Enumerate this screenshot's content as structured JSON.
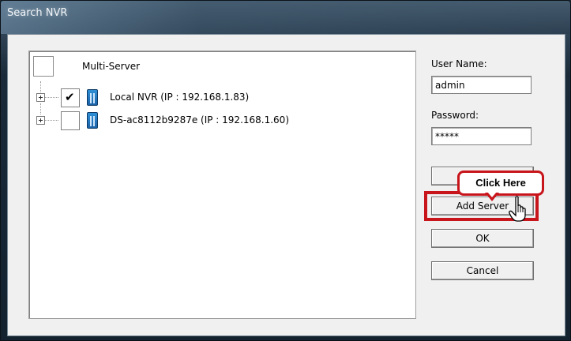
{
  "window": {
    "title": "Search NVR"
  },
  "tree": {
    "root": {
      "label": "Multi-Server",
      "checked": false
    },
    "nodes": [
      {
        "label": "Local NVR (IP : 192.168.1.83)",
        "checked": true,
        "icon": "nvr-icon"
      },
      {
        "label": "DS-ac8112b9287e (IP : 192.168.1.60)",
        "checked": false,
        "icon": "nvr-icon"
      }
    ]
  },
  "form": {
    "username_label": "User Name:",
    "username_value": "admin",
    "password_label": "Password:",
    "password_value": "*****"
  },
  "buttons": {
    "blank": "",
    "add_server": "Add Server",
    "ok": "OK",
    "cancel": "Cancel"
  },
  "annotation": {
    "callout": "Click Here",
    "color": "#c8151c"
  }
}
